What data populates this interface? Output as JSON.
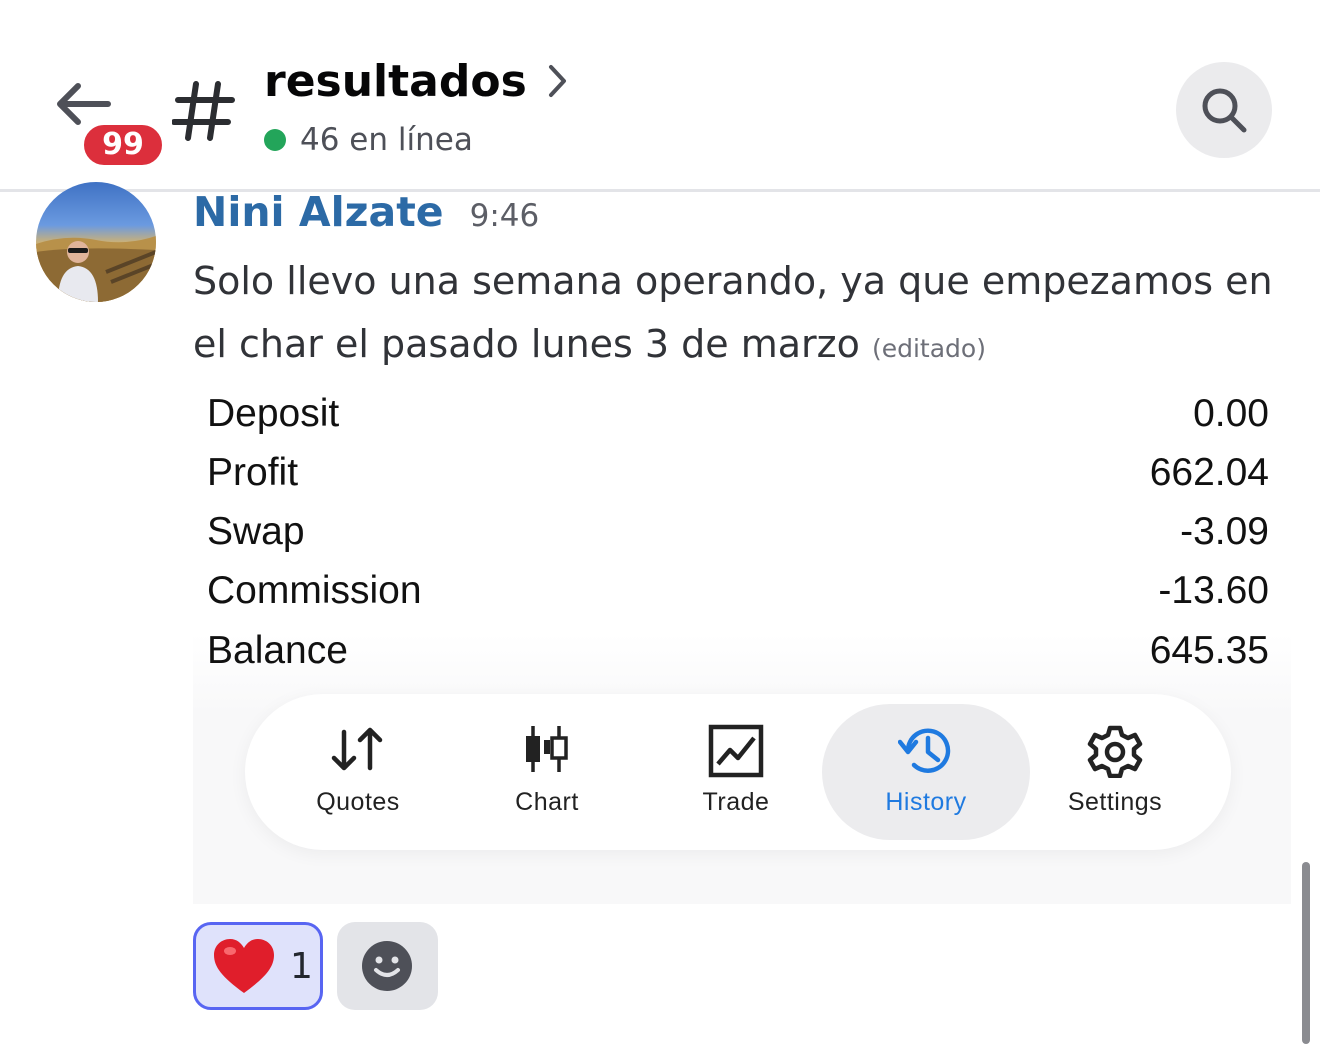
{
  "header": {
    "unread_badge": "99",
    "channel_name": "resultados",
    "online_text": "46 en línea"
  },
  "message": {
    "author": "Nini Alzate",
    "time": "9:46",
    "text": "Solo llevo una semana operando, ya que empezamos en el char el pasado lunes 3 de marzo",
    "edited_label": "(editado)"
  },
  "attachment": {
    "summary": [
      {
        "label": "Deposit",
        "value": "0.00"
      },
      {
        "label": "Profit",
        "value": "662.04"
      },
      {
        "label": "Swap",
        "value": "-3.09"
      },
      {
        "label": "Commission",
        "value": "-13.60"
      },
      {
        "label": "Balance",
        "value": "645.35"
      }
    ],
    "tabs": [
      {
        "label": "Quotes",
        "icon": "quotes-arrows-icon"
      },
      {
        "label": "Chart",
        "icon": "candlestick-chart-icon"
      },
      {
        "label": "Trade",
        "icon": "trade-line-chart-icon"
      },
      {
        "label": "History",
        "icon": "history-clock-icon",
        "active": true
      },
      {
        "label": "Settings",
        "icon": "gear-icon"
      }
    ],
    "active_tab_color": "#1f7ae0"
  },
  "reactions": {
    "heart_count": "1",
    "heart_emoji": "heart-emoji"
  },
  "colors": {
    "author": "#2c6aa6",
    "badge": "#dc2f3c",
    "online": "#23a55a",
    "reaction_border": "#5865f2"
  }
}
